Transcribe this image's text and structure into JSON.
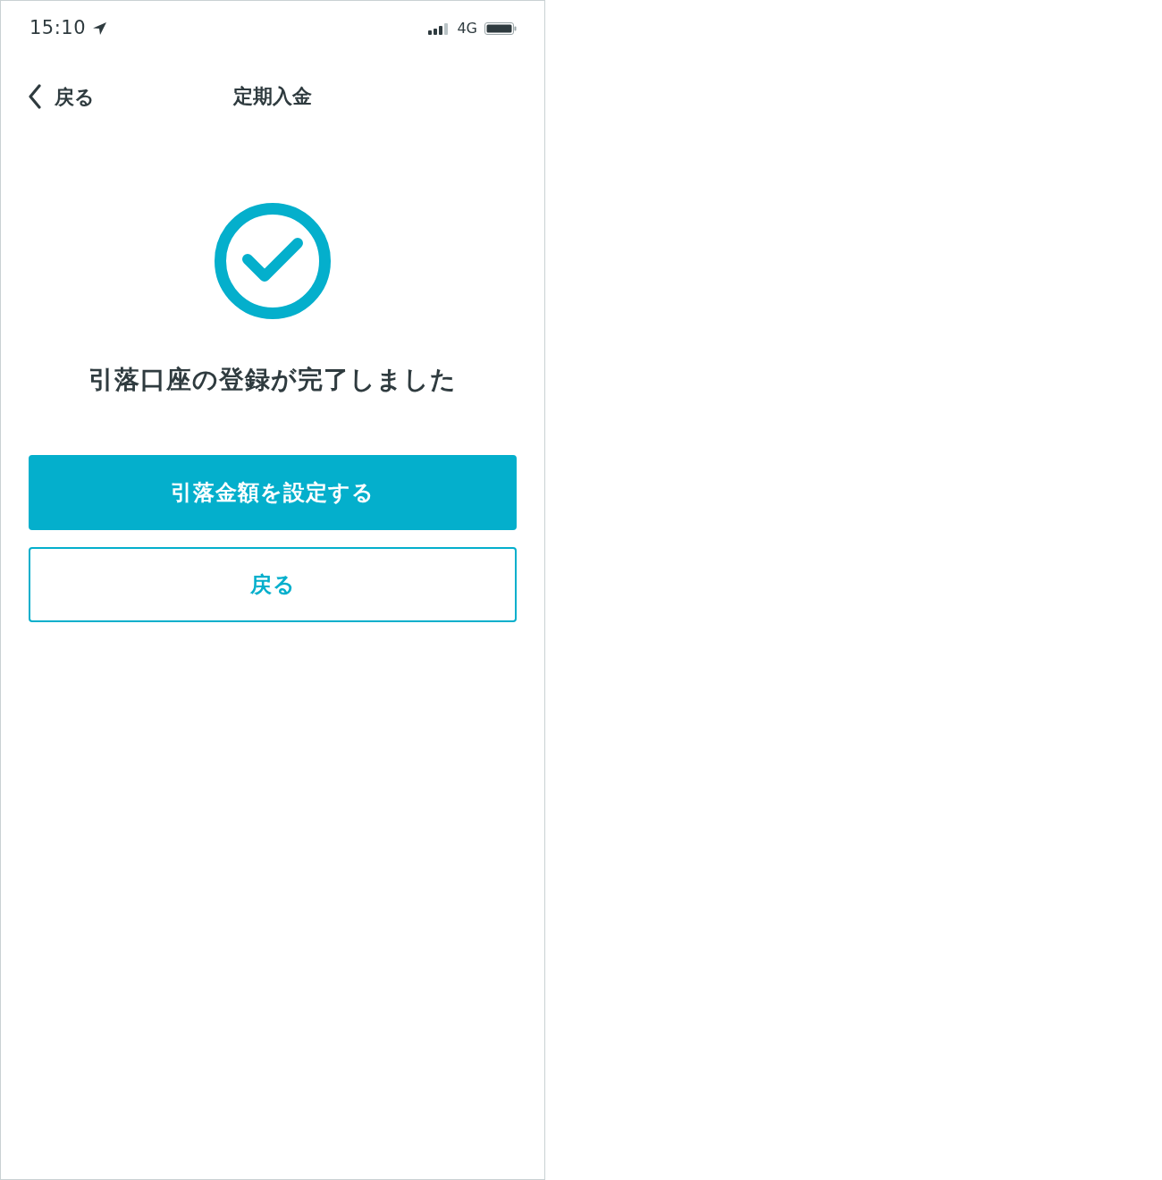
{
  "status_bar": {
    "time": "15:10",
    "network": "4G"
  },
  "nav_bar": {
    "back_label": "戻る",
    "title": "定期入金"
  },
  "message": "引落口座の登録が完了しました",
  "buttons": [
    {
      "label": "引落金額を設定する",
      "kind": "primary"
    },
    {
      "label": "戻る",
      "kind": "outline"
    }
  ]
}
